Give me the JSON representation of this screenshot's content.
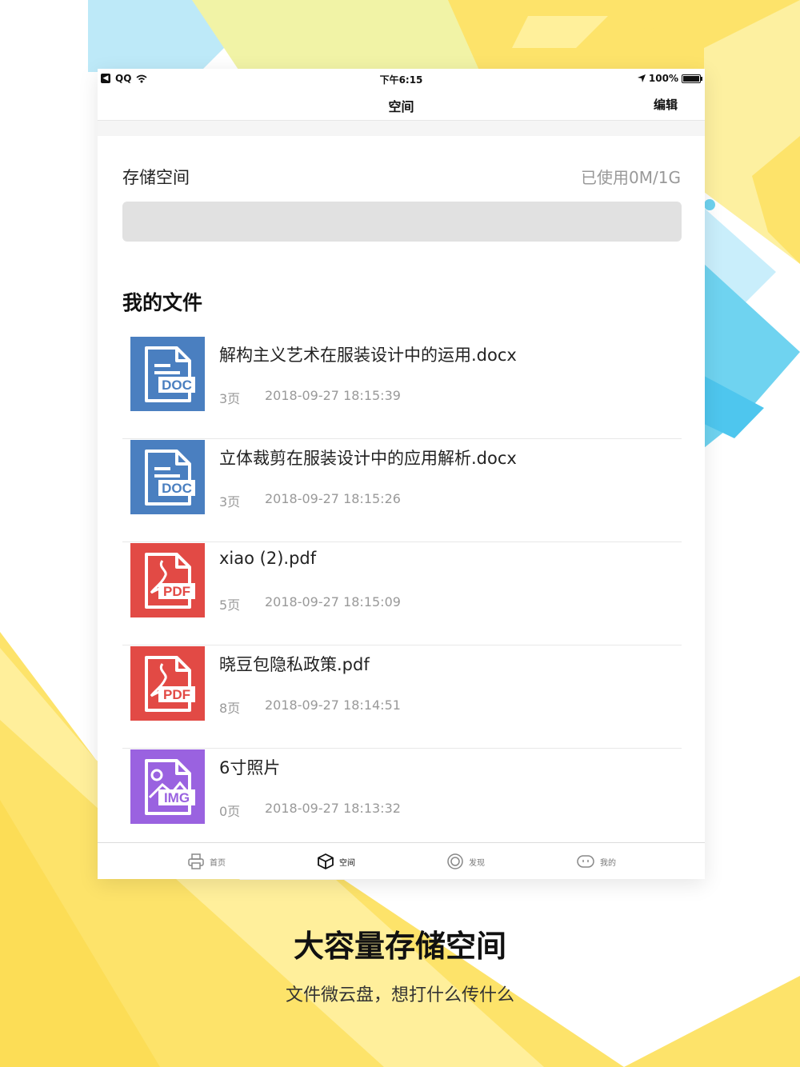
{
  "status_bar": {
    "back_app": "QQ",
    "time": "下午6:15",
    "battery": "100%"
  },
  "nav": {
    "title": "空间",
    "edit_label": "编辑"
  },
  "storage": {
    "label": "存储空间",
    "used_text": "已使用0M/1G",
    "used_fraction": 0
  },
  "files": {
    "title": "我的文件",
    "items": [
      {
        "name": "解构主义艺术在服装设计中的运用.docx",
        "pages": "3页",
        "time": "2018-09-27 18:15:39",
        "type": "DOC",
        "icon": "doc-file-icon"
      },
      {
        "name": "立体裁剪在服装设计中的应用解析.docx",
        "pages": "3页",
        "time": "2018-09-27 18:15:26",
        "type": "DOC",
        "icon": "doc-file-icon"
      },
      {
        "name": "xiao (2).pdf",
        "pages": "5页",
        "time": "2018-09-27 18:15:09",
        "type": "PDF",
        "icon": "pdf-file-icon"
      },
      {
        "name": "晓豆包隐私政策.pdf",
        "pages": "8页",
        "time": "2018-09-27 18:14:51",
        "type": "PDF",
        "icon": "pdf-file-icon"
      },
      {
        "name": "6寸照片",
        "pages": "0页",
        "time": "2018-09-27 18:13:32",
        "type": "IMG",
        "icon": "img-file-icon"
      }
    ]
  },
  "tabbar": {
    "items": [
      {
        "label": "首页",
        "icon": "printer-icon"
      },
      {
        "label": "空间",
        "icon": "box-icon",
        "active": true
      },
      {
        "label": "发现",
        "icon": "discover-ring-icon"
      },
      {
        "label": "我的",
        "icon": "face-icon"
      }
    ]
  },
  "promo": {
    "caption": "大容量存储空间",
    "subcaption": "文件微云盘，想打什么传什么"
  },
  "colors": {
    "doc_blue": "#4a7fc0",
    "pdf_red": "#e24a45",
    "img_purple": "#9a62e0",
    "accent_yellow": "#fde36a",
    "accent_cyan": "#6fd3f0"
  }
}
